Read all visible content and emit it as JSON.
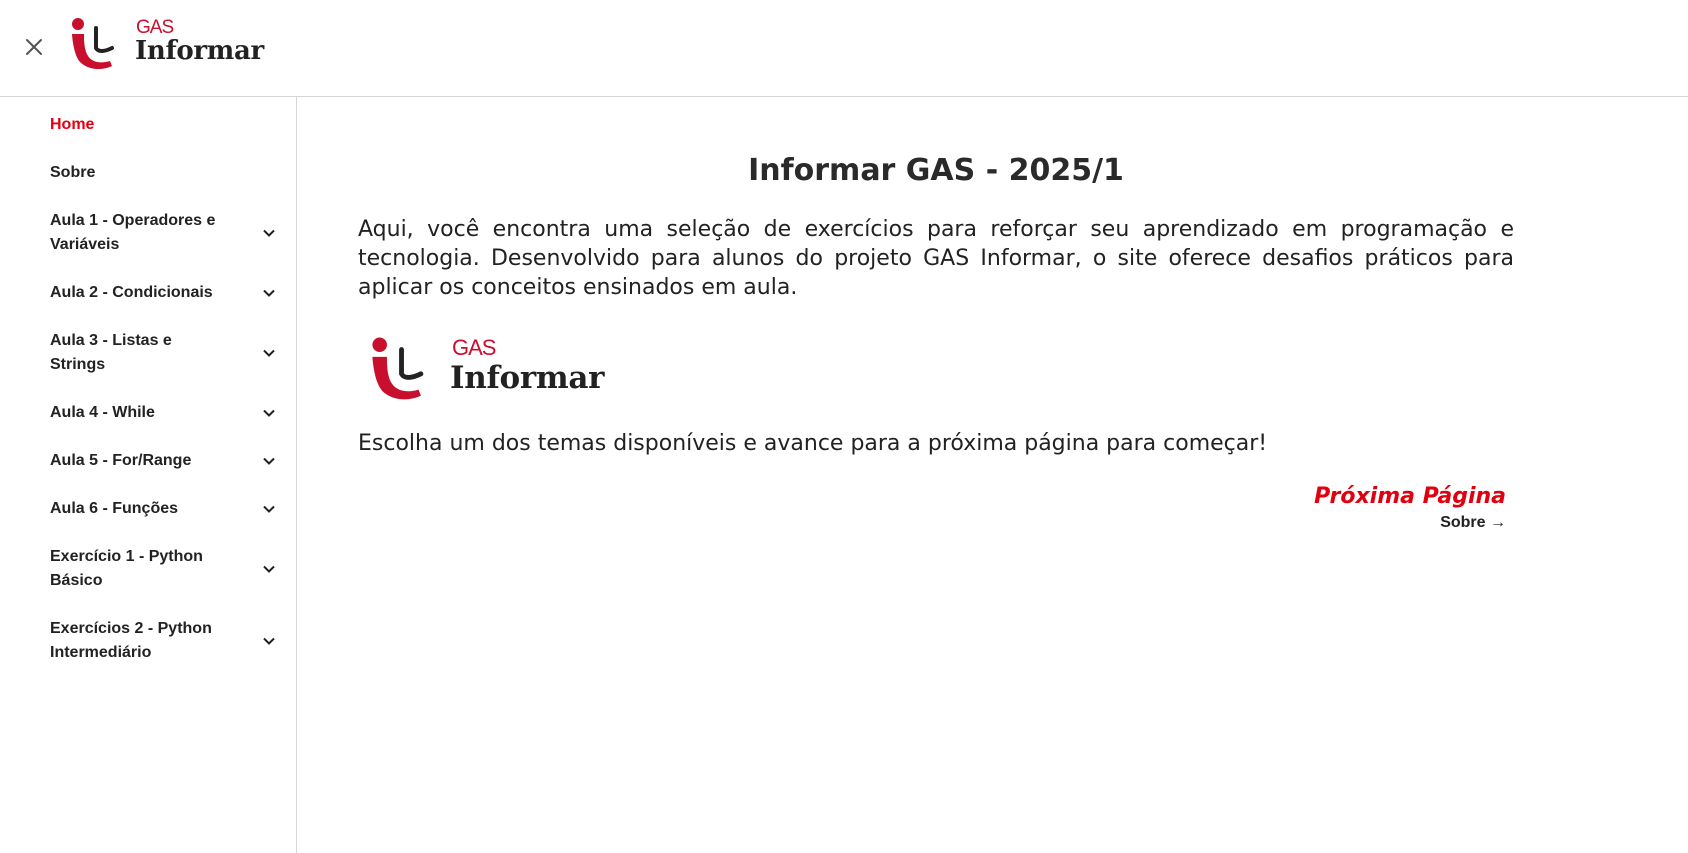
{
  "header": {
    "close_icon": "close-icon",
    "logo": {
      "small": "GAS",
      "big": "Informar"
    }
  },
  "sidebar": {
    "items": [
      {
        "label": "Home",
        "active": true,
        "expandable": false
      },
      {
        "label": "Sobre",
        "active": false,
        "expandable": false
      },
      {
        "label": "Aula 1 - Operadores e Variáveis",
        "active": false,
        "expandable": true
      },
      {
        "label": "Aula 2 - Condicionais",
        "active": false,
        "expandable": true
      },
      {
        "label": "Aula 3 - Listas e Strings",
        "active": false,
        "expandable": true
      },
      {
        "label": "Aula 4 - While",
        "active": false,
        "expandable": true
      },
      {
        "label": "Aula 5 - For/Range",
        "active": false,
        "expandable": true
      },
      {
        "label": "Aula 6 - Funções",
        "active": false,
        "expandable": true
      },
      {
        "label": "Exercício 1 - Python Básico",
        "active": false,
        "expandable": true
      },
      {
        "label": "Exercícios 2 - Python Intermediário",
        "active": false,
        "expandable": true
      }
    ]
  },
  "main": {
    "title": "Informar GAS - 2025/1",
    "intro": "Aqui, você encontra uma seleção de exercícios para reforçar seu aprendizado em programação e tecnologia. Desenvolvido para alunos do projeto GAS Informar, o site oferece desafios práticos para aplicar os conceitos ensinados em aula.",
    "logo": {
      "small": "GAS",
      "big": "Informar"
    },
    "cta": "Escolha um dos temas disponíveis e avance para a próxima página para começar!",
    "next": {
      "title": "Próxima Página",
      "subtitle": "Sobre →"
    }
  },
  "colors": {
    "accent": "#e0000f",
    "brand_red": "#c8102e",
    "text": "#222222",
    "border": "#d6d6d6"
  }
}
